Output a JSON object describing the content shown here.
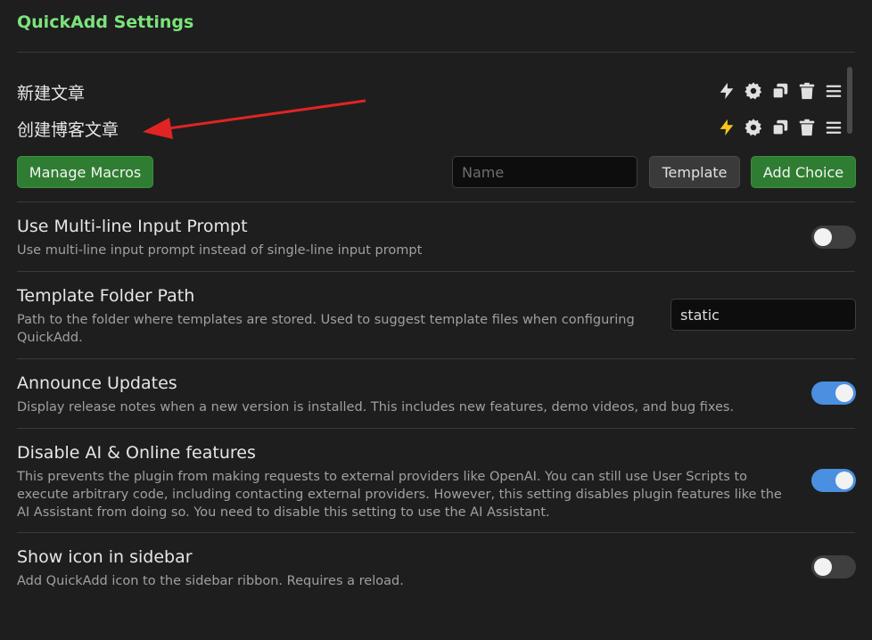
{
  "header": {
    "title": "QuickAdd Settings"
  },
  "choices": [
    {
      "name": "新建文章",
      "lightning_color": "#e0e0e0"
    },
    {
      "name": "创建博客文章",
      "lightning_color": "#f5c518"
    }
  ],
  "choice_icons": [
    "lightning-icon",
    "gear-icon",
    "duplicate-icon",
    "trash-icon",
    "drag-handle-icon"
  ],
  "toolbar": {
    "manage_macros_label": "Manage Macros",
    "name_placeholder": "Name",
    "template_label": "Template",
    "add_choice_label": "Add Choice"
  },
  "settings": {
    "multiline": {
      "name": "Use Multi-line Input Prompt",
      "desc": "Use multi-line input prompt instead of single-line input prompt",
      "enabled": false
    },
    "template_folder": {
      "name": "Template Folder Path",
      "desc": "Path to the folder where templates are stored. Used to suggest template files when configuring QuickAdd.",
      "value": "static"
    },
    "announce": {
      "name": "Announce Updates",
      "desc": "Display release notes when a new version is installed. This includes new features, demo videos, and bug fixes.",
      "enabled": true
    },
    "disable_ai": {
      "name": "Disable AI & Online features",
      "desc": "This prevents the plugin from making requests to external providers like OpenAI. You can still use User Scripts to execute arbitrary code, including contacting external providers. However, this setting disables plugin features like the AI Assistant from doing so. You need to disable this setting to use the AI Assistant.",
      "enabled": true
    },
    "sidebar_icon": {
      "name": "Show icon in sidebar",
      "desc": "Add QuickAdd icon to the sidebar ribbon. Requires a reload.",
      "enabled": false
    }
  },
  "colors": {
    "title": "#7be37b",
    "accent_green": "#2f7d32",
    "toggle_on": "#4a8fe0",
    "arrow": "#e02424"
  }
}
